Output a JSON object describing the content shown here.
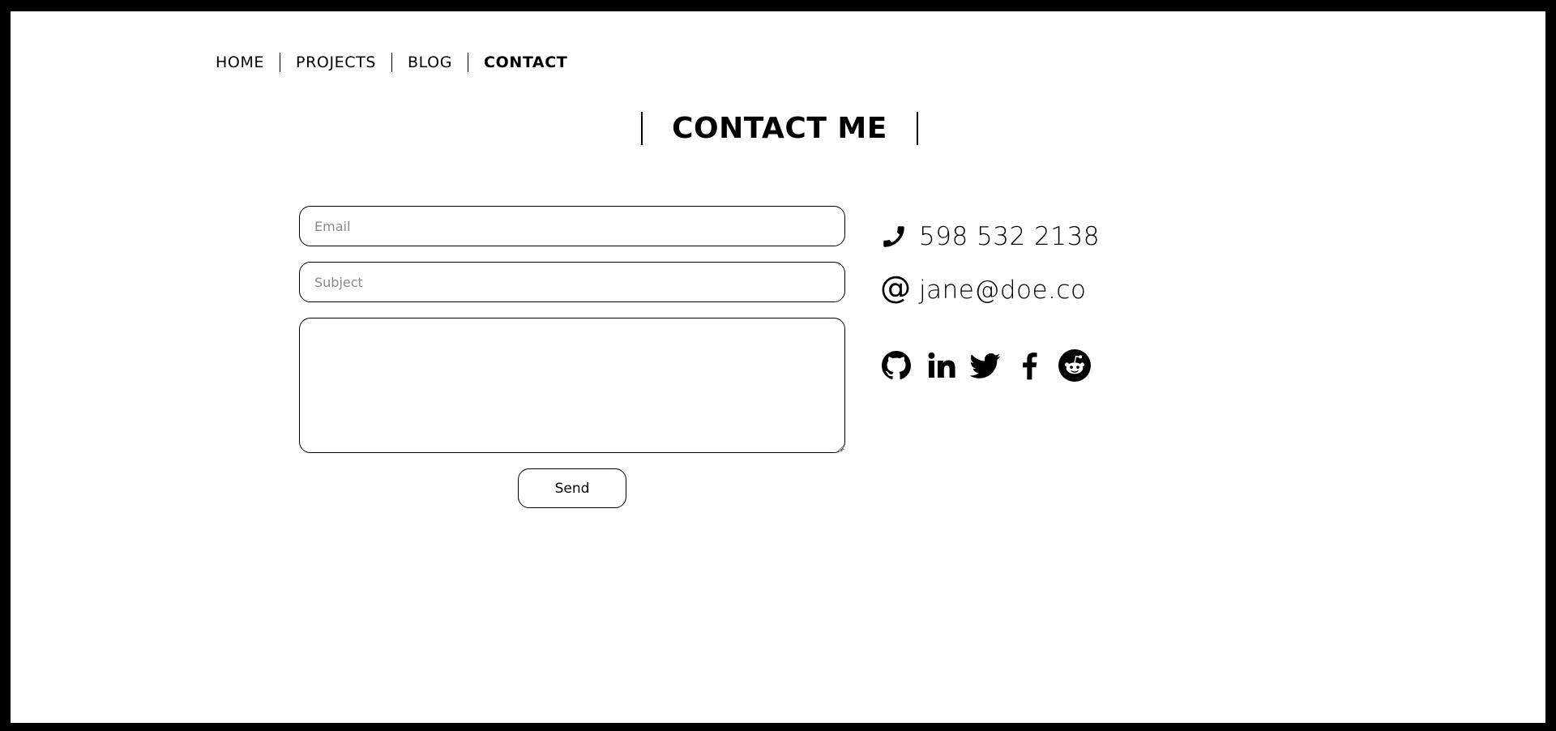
{
  "nav": {
    "items": [
      {
        "label": "HOME"
      },
      {
        "label": "PROJECTS"
      },
      {
        "label": "BLOG"
      },
      {
        "label": "CONTACT",
        "active": true
      }
    ]
  },
  "page": {
    "title": "CONTACT ME"
  },
  "form": {
    "email_placeholder": "Email",
    "subject_placeholder": "Subject",
    "message_placeholder": "",
    "send_label": "Send"
  },
  "contact": {
    "phone": "598 532 2138",
    "phone_icon": "phone-icon",
    "email": "jane@doe.co",
    "email_icon": "at-sign-icon",
    "at_glyph": "@"
  },
  "socials": [
    {
      "icon": "github-icon"
    },
    {
      "icon": "linkedin-icon"
    },
    {
      "icon": "twitter-icon"
    },
    {
      "icon": "facebook-icon"
    },
    {
      "icon": "reddit-icon"
    }
  ],
  "colors": {
    "background": "#ffffff",
    "frame": "#000000",
    "text": "#000000",
    "placeholder": "#8a8a8a"
  }
}
